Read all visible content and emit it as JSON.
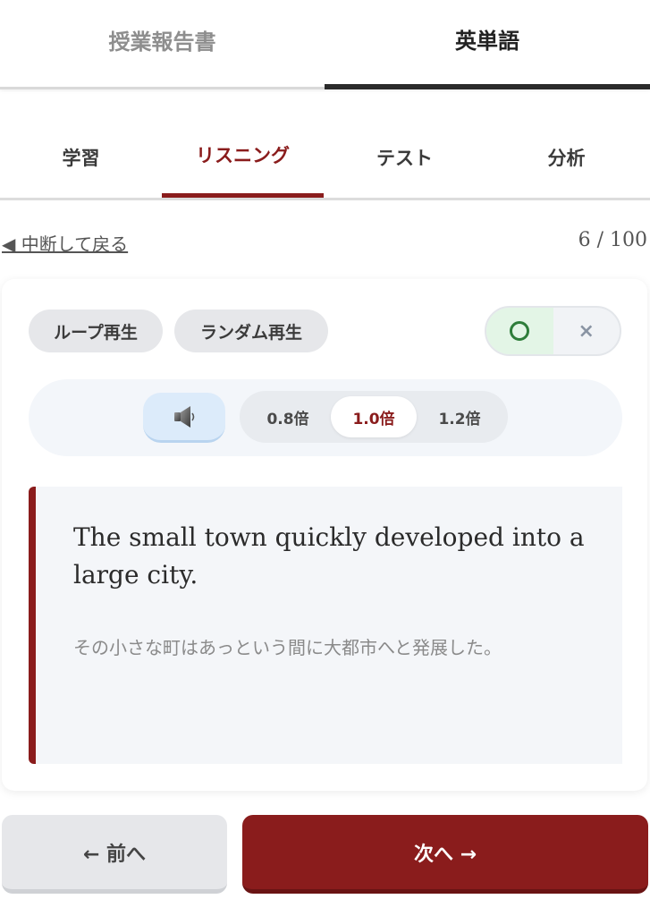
{
  "top_tabs": [
    {
      "label": "授業報告書",
      "active": false
    },
    {
      "label": "英単語",
      "active": true
    }
  ],
  "sub_tabs": [
    {
      "label": "学習",
      "active": false
    },
    {
      "label": "リスニング",
      "active": true
    },
    {
      "label": "テスト",
      "active": false
    },
    {
      "label": "分析",
      "active": false
    }
  ],
  "back_link": "◀ 中断して戻る",
  "progress": "6 / 100",
  "controls": {
    "loop_label": "ループ再生",
    "random_label": "ランダム再生",
    "correct_icon": "circle-icon",
    "wrong_icon": "cross-icon",
    "wrong_label": "×"
  },
  "audio": {
    "speaker_icon": "speaker-icon",
    "speeds": [
      "0.8倍",
      "1.0倍",
      "1.2倍"
    ],
    "selected_speed": "1.0倍"
  },
  "sentence": {
    "english": "The small town quickly developed into a large city.",
    "japanese": "その小さな町はあっという間に大都市へと発展した。"
  },
  "nav": {
    "prev_label": "← 前へ",
    "next_label": "次へ →"
  },
  "colors": {
    "accent": "#8a1c1c",
    "speaker_bg": "#dcebfa",
    "correct_bg": "#e3f5e6"
  }
}
